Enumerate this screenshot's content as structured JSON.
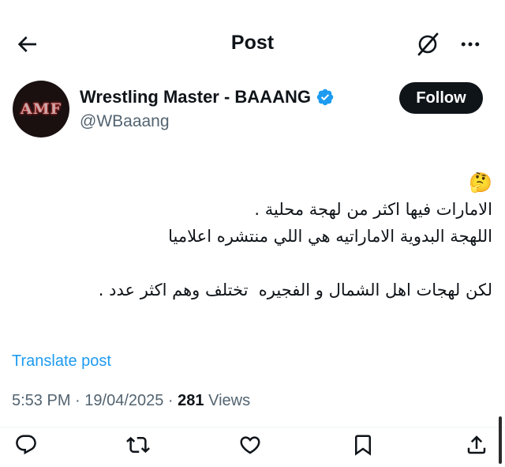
{
  "header": {
    "title": "Post",
    "back_icon": "arrow-left-icon",
    "grok_icon": "grok-icon",
    "more_icon": "more-horizontal-icon"
  },
  "author": {
    "display_name": "Wrestling Master - BAAANG",
    "handle": "@WBaaang",
    "avatar_text": "AMF",
    "verified": true,
    "verified_color": "#1d9bf0",
    "follow_label": "Follow"
  },
  "post": {
    "emoji": "🤔",
    "lines": [
      "الامارات فيها اكثر من لهجة محلية .",
      "اللهجة البدوية الاماراتيه هي اللي منتشره اعلاميا",
      "لكن لهجات اهل الشمال و الفجيره  تختلف وهم اكثر عدد ."
    ],
    "translate_label": "Translate post"
  },
  "meta": {
    "time": "5:53 PM",
    "separator": " · ",
    "date": "19/04/2025",
    "views_count": "281",
    "views_label": " Views"
  },
  "actions": {
    "reply_icon": "reply-icon",
    "repost_icon": "repost-icon",
    "like_icon": "like-icon",
    "bookmark_icon": "bookmark-icon",
    "share_icon": "share-icon"
  },
  "colors": {
    "accent": "#1d9bf0",
    "text": "#0f1419",
    "secondary": "#536471"
  }
}
